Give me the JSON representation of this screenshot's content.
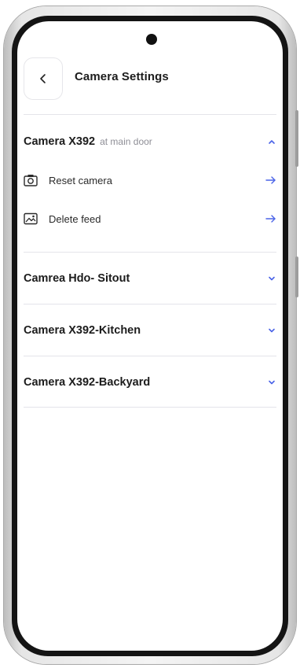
{
  "header": {
    "title": "Camera Settings",
    "back_icon": "chevron-left-icon"
  },
  "colors": {
    "accent": "#4a63e7",
    "text": "#1c1c1c",
    "muted": "#8e8e96",
    "divider": "#e4e4ea"
  },
  "cameras": [
    {
      "name": "Camera X392",
      "location": "at main door",
      "expanded": true,
      "chevron_icon": "chevron-up-icon",
      "actions": [
        {
          "label": "Reset camera",
          "icon": "camera-icon",
          "arrow_icon": "arrow-right-icon"
        },
        {
          "label": "Delete feed",
          "icon": "image-icon",
          "arrow_icon": "arrow-right-icon"
        }
      ]
    },
    {
      "name": "Camrea Hdo- Sitout",
      "expanded": false,
      "chevron_icon": "chevron-down-icon"
    },
    {
      "name": "Camera X392-Kitchen",
      "expanded": false,
      "chevron_icon": "chevron-down-icon"
    },
    {
      "name": "Camera X392-Backyard",
      "expanded": false,
      "chevron_icon": "chevron-down-icon"
    }
  ]
}
